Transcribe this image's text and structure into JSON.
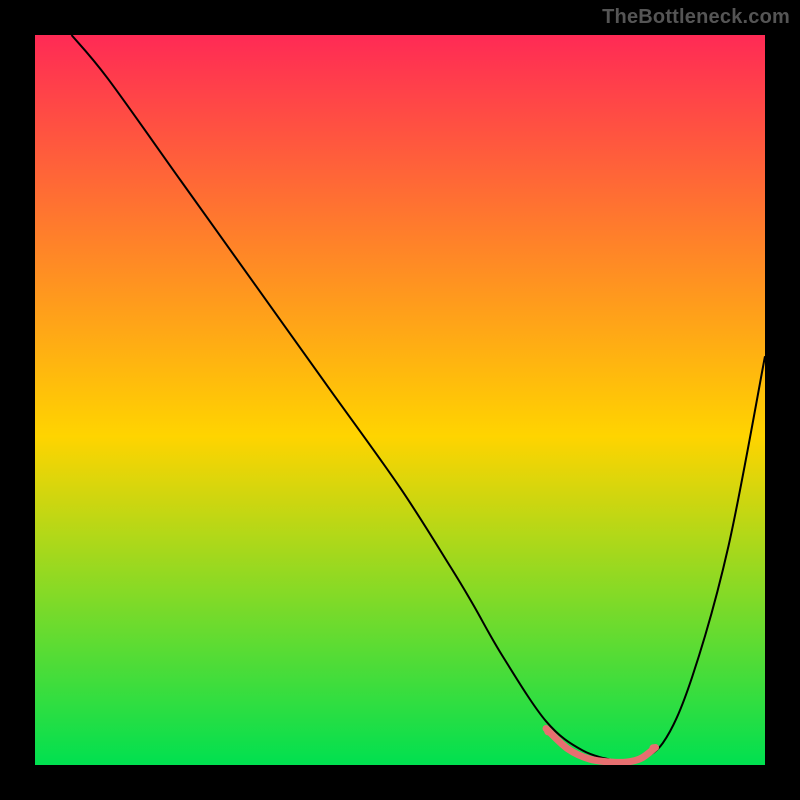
{
  "watermark": "TheBottleneck.com",
  "chart_data": {
    "type": "line",
    "title": "",
    "xlabel": "",
    "ylabel": "",
    "xlim": [
      0,
      100
    ],
    "ylim": [
      0,
      100
    ],
    "grid": false,
    "legend": false,
    "background_gradient_vertical": {
      "top": "#ff2a55",
      "mid": "#ffd400",
      "bottom": "#00e050"
    },
    "series": [
      {
        "name": "curve-outline",
        "stroke": "#000000",
        "x": [
          5,
          10,
          20,
          30,
          40,
          50,
          57,
          60,
          64,
          70,
          75,
          80,
          82,
          86,
          90,
          95,
          100
        ],
        "values": [
          100,
          94,
          80,
          66,
          52,
          38,
          27,
          22,
          15,
          6,
          2,
          0.5,
          0.5,
          3,
          12,
          30,
          56
        ]
      },
      {
        "name": "valley-highlight",
        "stroke": "#e76f70",
        "stroke_width": 7,
        "x": [
          70,
          73,
          76,
          79,
          81,
          83,
          85
        ],
        "values": [
          5,
          2.2,
          0.8,
          0.4,
          0.4,
          0.9,
          2.4
        ]
      }
    ],
    "highlight_dots": {
      "fill": "#e76f70",
      "radius": 4,
      "points": [
        {
          "x": 70.3,
          "y": 4.6
        },
        {
          "x": 84.7,
          "y": 2.3
        }
      ]
    }
  }
}
